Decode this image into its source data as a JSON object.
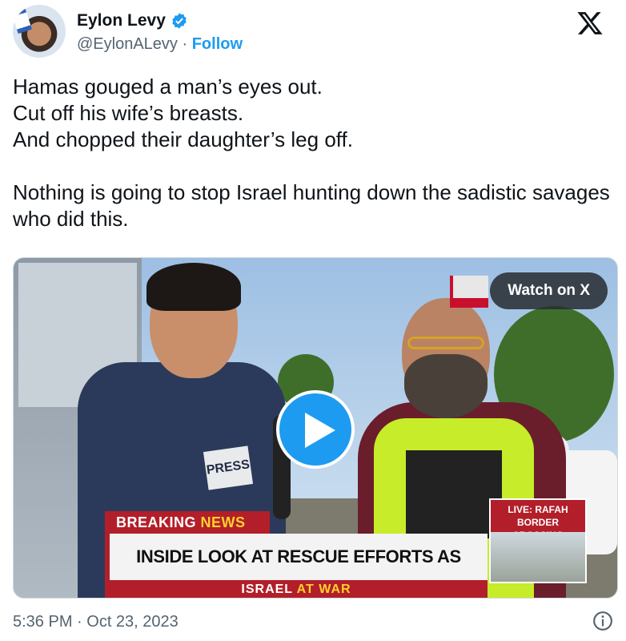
{
  "author": {
    "name": "Eylon Levy",
    "handle": "@EylonALevy",
    "separator": " · ",
    "follow_label": "Follow",
    "verified": true,
    "avatar_icon": "profile-avatar"
  },
  "brand_icon": "x-logo-icon",
  "tweet": {
    "text": "Hamas gouged a man’s eyes out.\nCut off his wife’s breasts.\nAnd chopped their daughter’s leg off.\n\nNothing is going to stop Israel hunting down the sadistic savages who did this."
  },
  "media": {
    "watch_label": "Watch on X",
    "play_icon": "play-icon",
    "press_label": "PRESS",
    "chyron": {
      "breaking": "BREAKING",
      "news": "NEWS",
      "headline": "INSIDE LOOK AT RESCUE EFFORTS AS ISRAEL WAR RAGES",
      "israel": "ISRAEL",
      "at_war": "AT WAR"
    },
    "live_label": "LIVE: RAFAH BORDER CROSSING"
  },
  "footer": {
    "timestamp": "5:36 PM · Oct 23, 2023",
    "info_icon": "info-icon"
  },
  "colors": {
    "accent": "#1d9bf0",
    "text_primary": "#0f1419",
    "text_secondary": "#536471",
    "news_red": "#b21f2a",
    "news_yellow": "#ffd12b"
  }
}
